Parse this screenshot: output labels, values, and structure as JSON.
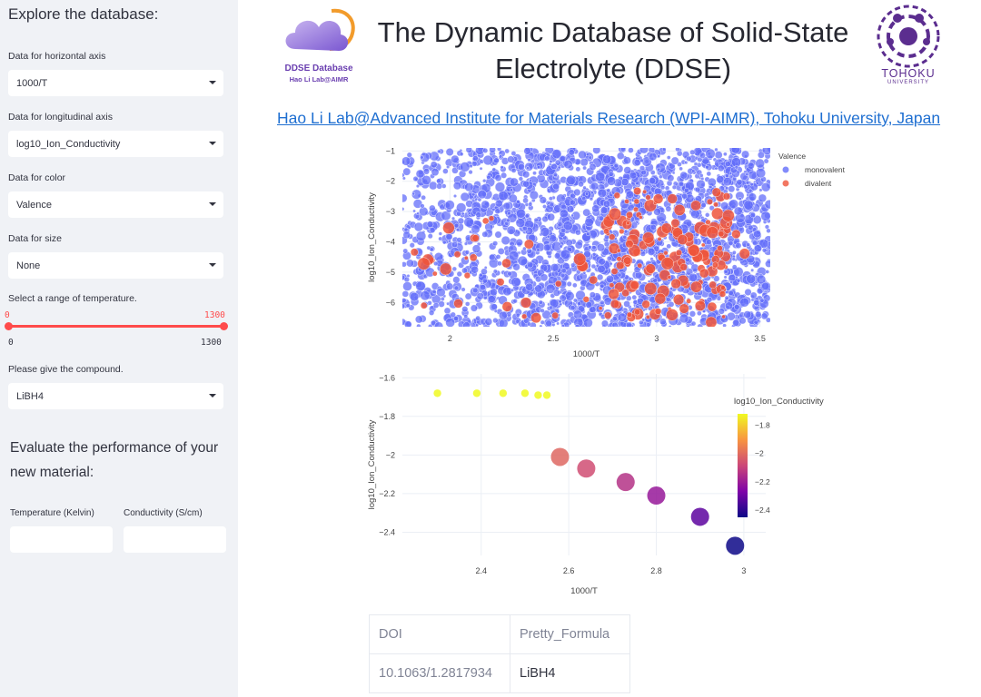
{
  "sidebar": {
    "title": "Explore the database:",
    "horizontal_axis": {
      "label": "Data for horizontal axis",
      "value": "1000/T"
    },
    "longitudinal_axis": {
      "label": "Data for longitudinal axis",
      "value": "log10_Ion_Conductivity"
    },
    "color": {
      "label": "Data for color",
      "value": "Valence"
    },
    "size": {
      "label": "Data for size",
      "value": "None"
    },
    "temperature": {
      "label": "Select a range of temperature.",
      "min": "0",
      "max": "1300",
      "low": 0,
      "high": 1300
    },
    "compound": {
      "label": "Please give the compound.",
      "value": "LiBH4"
    },
    "evaluate": {
      "title": "Evaluate the performance of your new material:",
      "temperature_label": "Temperature (Kelvin)",
      "conductivity_label": "Conductivity (S/cm)",
      "temperature_value": "",
      "conductivity_value": ""
    }
  },
  "header": {
    "logo_line1": "DDSE Database",
    "logo_line2": "Hao Li Lab@AIMR",
    "title": "The Dynamic Database of Solid-State Electrolyte (DDSE)",
    "univ_line1": "TOHOKU",
    "univ_line2": "UNIVERSITY",
    "link": "Hao Li Lab@Advanced Institute for Materials Research (WPI-AIMR), Tohoku University, Japan"
  },
  "colors": {
    "monovalent": "#636efa",
    "divalent": "#ef553b",
    "accent": "#ff4b4b"
  },
  "chart_data": [
    {
      "type": "scatter",
      "xlabel": "1000/T",
      "ylabel": "log10_Ion_Conductivity",
      "xlim": [
        1.77,
        3.55
      ],
      "ylim": [
        -6.8,
        -0.9
      ],
      "xticks": [
        2,
        2.5,
        3,
        3.5
      ],
      "yticks": [
        -1,
        -2,
        -3,
        -4,
        -5,
        -6
      ],
      "legend": {
        "title": "Valence",
        "position": "top-right"
      },
      "series": [
        {
          "name": "monovalent",
          "color": "#636efa",
          "points": "dense cloud across full range"
        },
        {
          "name": "divalent",
          "color": "#ef553b",
          "points": "concentrated around x 2.8-3.3, y -2.5 to -6.5"
        }
      ]
    },
    {
      "type": "scatter",
      "xlabel": "1000/T",
      "ylabel": "log10_Ion_Conductivity",
      "xlim": [
        2.22,
        3.05
      ],
      "ylim": [
        -2.52,
        -1.58
      ],
      "xticks": [
        2.4,
        2.6,
        2.8,
        3
      ],
      "yticks": [
        -1.6,
        -1.8,
        -2,
        -2.2,
        -2.4
      ],
      "colorbar": {
        "title": "log10_Ion_Conductivity",
        "ticks": [
          -1.8,
          -2,
          -2.2,
          -2.4
        ],
        "range": [
          -2.45,
          -1.72
        ]
      },
      "points": [
        {
          "x": 2.3,
          "y": -1.68,
          "size": "small"
        },
        {
          "x": 2.39,
          "y": -1.68,
          "size": "small"
        },
        {
          "x": 2.45,
          "y": -1.68,
          "size": "small"
        },
        {
          "x": 2.5,
          "y": -1.68,
          "size": "small"
        },
        {
          "x": 2.53,
          "y": -1.69,
          "size": "small"
        },
        {
          "x": 2.55,
          "y": -1.69,
          "size": "small"
        },
        {
          "x": 2.58,
          "y": -2.01,
          "size": "large"
        },
        {
          "x": 2.64,
          "y": -2.07,
          "size": "large"
        },
        {
          "x": 2.73,
          "y": -2.14,
          "size": "large"
        },
        {
          "x": 2.8,
          "y": -2.21,
          "size": "large"
        },
        {
          "x": 2.9,
          "y": -2.32,
          "size": "large"
        },
        {
          "x": 2.98,
          "y": -2.47,
          "size": "large"
        }
      ]
    }
  ],
  "table": {
    "headers": [
      "DOI",
      "Pretty_Formula"
    ],
    "rows": [
      [
        "10.1063/1.2817934",
        "LiBH4"
      ]
    ]
  }
}
